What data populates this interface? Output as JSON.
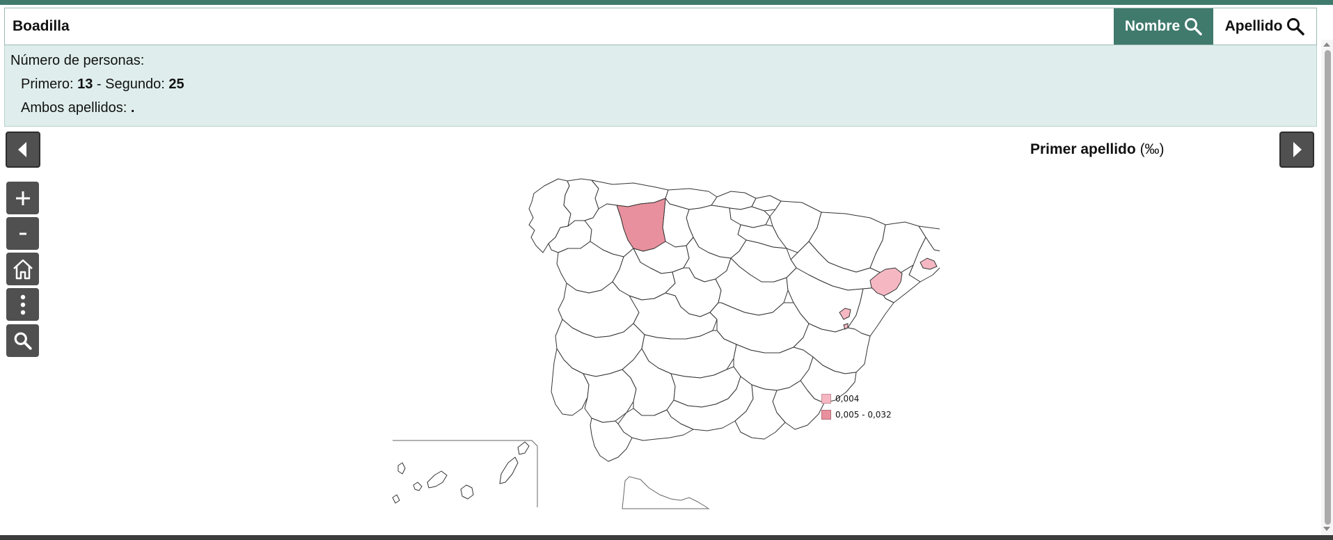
{
  "search": {
    "value": "Boadilla",
    "btn_nombre": "Nombre",
    "btn_apellido": "Apellido"
  },
  "info": {
    "heading": "Número de personas:",
    "primero_label": "Primero: ",
    "primero_value": "13",
    "separator": " - Segundo: ",
    "segundo_value": "25",
    "ambos_label": "Ambos apellidos: ",
    "ambos_value": "."
  },
  "map": {
    "title": "Primer apellido",
    "unit": "(‰)",
    "legend": [
      {
        "label": "0,004",
        "color": "#f5b8c3"
      },
      {
        "label": "0,005 - 0,032",
        "color": "#e8909d"
      }
    ]
  },
  "controls": {
    "zoom_in": "plus-icon",
    "zoom_out": "minus-icon",
    "home": "home-icon",
    "more": "more-vertical-icon",
    "search": "search-icon",
    "prev": "triangle-left-icon",
    "next": "triangle-right-icon"
  },
  "colors": {
    "accent": "#3f7a6d",
    "panel": "#dfeeec",
    "control": "#505050"
  }
}
